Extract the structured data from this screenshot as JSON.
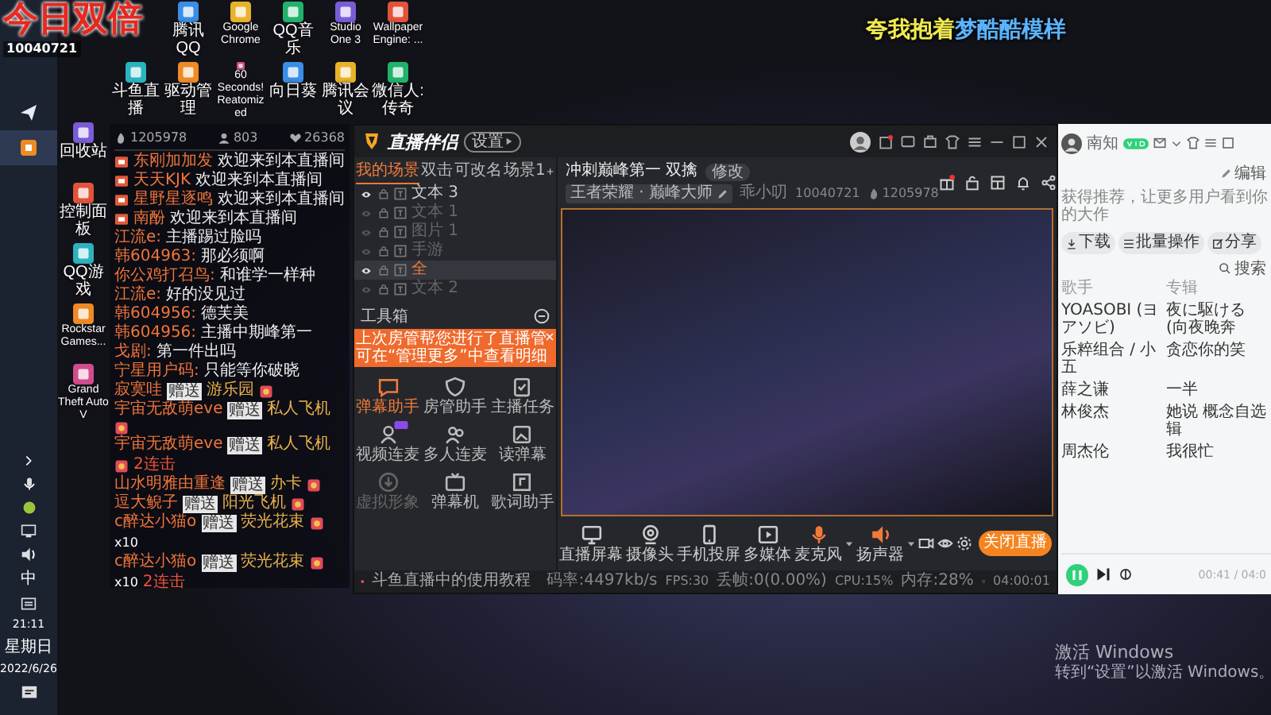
{
  "overlay": {
    "badge": "今日双倍",
    "room_id": "10040721"
  },
  "lyric": {
    "text": "夸我抱着梦酷酷模样",
    "level": 0.45
  },
  "taskbar": {
    "ime": "中",
    "time": "21:11",
    "weekday": "星期日",
    "date": "2022/6/26"
  },
  "desktop": {
    "top_rows": [
      [
        "腾讯QQ",
        "Google Chrome",
        "QQ音乐",
        "Studio One 3",
        "Wallpaper Engine: ..."
      ],
      [
        "斗鱼直播",
        "驱动管理",
        "60 Seconds! Reatomized",
        "向日葵",
        "腾讯会议",
        "微信人: 传奇"
      ]
    ],
    "left_column": [
      "回收站",
      "控制面板",
      "QQ游戏",
      "Rockstar Games...",
      "Grand Theft Auto V"
    ]
  },
  "chat": {
    "stats": [
      "1205978",
      "803",
      "26368"
    ],
    "messages": [
      {
        "kind": "enter",
        "name": "东刚加加发",
        "text": "欢迎来到本直播间"
      },
      {
        "kind": "enter",
        "name": "天天KJK",
        "text": "欢迎来到本直播间"
      },
      {
        "kind": "enter",
        "name": "星野星逐鸣",
        "text": "欢迎来到本直播间"
      },
      {
        "kind": "enter",
        "name": "南酚",
        "text": "欢迎来到本直播间"
      },
      {
        "kind": "chat",
        "name": "江流e:",
        "text": "主播踢过脸吗"
      },
      {
        "kind": "chat",
        "name": "韩604963:",
        "text": "那必须啊"
      },
      {
        "kind": "chat",
        "name": "你公鸡打召鸟:",
        "text": "和谁学一样种"
      },
      {
        "kind": "chat",
        "name": "江流e:",
        "text": "好的没见过"
      },
      {
        "kind": "chat",
        "name": "韩604956:",
        "text": "德芙美"
      },
      {
        "kind": "chat",
        "name": "韩604956:",
        "text": "主播中期峰第一"
      },
      {
        "kind": "chat",
        "name": "戈剧:",
        "text": "第一件出吗"
      },
      {
        "kind": "chat",
        "name": "宁星用户码:",
        "text": "只能等你破晓"
      },
      {
        "kind": "gift",
        "name": "寂寞哇",
        "action": "赠送",
        "gift": "游乐园"
      },
      {
        "kind": "gift",
        "name": "宇宙无敌萌eve",
        "action": "赠送",
        "gift": "私人飞机"
      },
      {
        "kind": "gift",
        "name": "宇宙无敌萌eve",
        "action": "赠送",
        "gift": "私人飞机",
        "combo": "2连击"
      },
      {
        "kind": "gift",
        "name": "山水明雅由重逢",
        "action": "赠送",
        "gift": "办卡"
      },
      {
        "kind": "gift",
        "name": "逗大鲵子",
        "action": "赠送",
        "gift": "阳光飞机"
      },
      {
        "kind": "gift",
        "name": "c醉达小猫o",
        "action": "赠送",
        "gift": "荧光花束",
        "count": "x10"
      },
      {
        "kind": "gift",
        "name": "c醉达小猫o",
        "action": "赠送",
        "gift": "荧光花束",
        "count": "x10",
        "combo": "2连击"
      }
    ]
  },
  "stream_app": {
    "title": "直播伴侣",
    "settings": "设置",
    "scene_tabs": [
      {
        "label": "我的场景",
        "selected": true
      },
      {
        "label": "双击",
        "selected": false
      },
      {
        "label": "可改名",
        "selected": false
      },
      {
        "label": "场景1",
        "selected": false
      }
    ],
    "sources": [
      {
        "name": "文本 3",
        "visible": true,
        "selected": false
      },
      {
        "name": "文本 1",
        "visible": false,
        "selected": false
      },
      {
        "name": "图片 1",
        "visible": false,
        "selected": false
      },
      {
        "name": "手游",
        "visible": false,
        "selected": false
      },
      {
        "name": "全",
        "visible": true,
        "selected": true
      },
      {
        "name": "文本 2",
        "visible": false,
        "selected": false
      }
    ],
    "toolbox_label": "工具箱",
    "toast": {
      "lines": [
        "上次房管帮您进行了直播管",
        "可在“管理更多”中查看明细"
      ]
    },
    "tools": [
      {
        "label": "弹幕助手",
        "selected": true,
        "new": false,
        "disabled": false
      },
      {
        "label": "房管助手",
        "selected": false,
        "new": false,
        "disabled": false
      },
      {
        "label": "主播任务",
        "selected": false,
        "new": false,
        "disabled": false
      },
      {
        "label": "视频连麦",
        "selected": false,
        "new": true,
        "disabled": false
      },
      {
        "label": "多人连麦",
        "selected": false,
        "new": false,
        "disabled": false
      },
      {
        "label": "读弹幕",
        "selected": false,
        "new": false,
        "disabled": false
      },
      {
        "label": "虚拟形象",
        "selected": false,
        "new": false,
        "disabled": true
      },
      {
        "label": "弹幕机",
        "selected": false,
        "new": false,
        "disabled": false
      },
      {
        "label": "歌词助手",
        "selected": false,
        "new": false,
        "disabled": false
      }
    ],
    "live_info": {
      "title": "冲刺巅峰第一 双擒",
      "edit_tag": "修改",
      "category": "王者荣耀 · 巅峰大师",
      "streamer": "乖小叨",
      "room_id": "10040721",
      "popularity": "1205978"
    },
    "controls": [
      {
        "label": "直播屏幕",
        "dropdown": false
      },
      {
        "label": "摄像头",
        "dropdown": false
      },
      {
        "label": "手机投屏",
        "dropdown": false
      },
      {
        "label": "多媒体",
        "dropdown": false
      },
      {
        "label": "麦克风",
        "dropdown": true
      },
      {
        "label": "扬声器",
        "dropdown": true
      }
    ],
    "end_button": "关闭直播",
    "status": {
      "tutorial": "斗鱼直播中的使用教程",
      "metrics": [
        "码率:4497kb/s",
        "FPS:30",
        "丢帧:0(0.00%)",
        "CPU:15%",
        "内存:28%"
      ],
      "duration": "04:00:01"
    }
  },
  "music_app": {
    "user": "南知",
    "vip": true,
    "edit": "编辑",
    "promo": "获得推荐，让更多用户看到你的大作",
    "buttons": [
      "下载",
      "批量操作",
      "分享"
    ],
    "search": "搜索",
    "columns": [
      "歌手",
      "专辑"
    ],
    "rows": [
      [
        "YOASOBI (ヨアソビ)",
        "夜に駆ける (向夜晚奔"
      ],
      [
        "乐粹组合 / 小五",
        "贪恋你的笑"
      ],
      [
        "薛之谦",
        "一半"
      ],
      [
        "林俊杰",
        "她说 概念自选辑"
      ],
      [
        "周杰伦",
        "我很忙"
      ]
    ],
    "player": {
      "playing": true,
      "time": "00:41 / 04:0"
    }
  },
  "os_notice": {
    "title": "激活 Windows",
    "hint": "转到“设置”以激活 Windows。"
  }
}
